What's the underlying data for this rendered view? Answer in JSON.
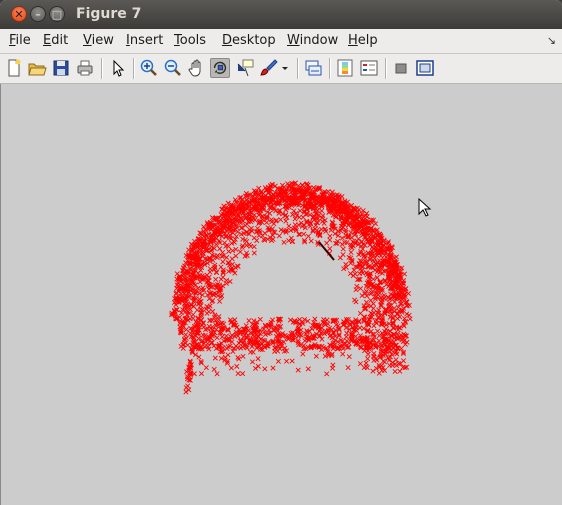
{
  "window": {
    "title": "Figure 7"
  },
  "titlebar_buttons": [
    {
      "name": "close-button",
      "glyph": "✕"
    },
    {
      "name": "minimize-button",
      "glyph": "–"
    },
    {
      "name": "maximize-button",
      "glyph": "□"
    }
  ],
  "menu": {
    "items": [
      {
        "label": "File",
        "mnemonic": "F",
        "rest": "ile"
      },
      {
        "label": "Edit",
        "mnemonic": "E",
        "rest": "dit"
      },
      {
        "label": "View",
        "mnemonic": "V",
        "rest": "iew"
      },
      {
        "label": "Insert",
        "mnemonic": "I",
        "rest": "nsert"
      },
      {
        "label": "Tools",
        "mnemonic": "T",
        "rest": "ools"
      },
      {
        "label": "Desktop",
        "mnemonic": "D",
        "rest": "esktop"
      },
      {
        "label": "Window",
        "mnemonic": "W",
        "rest": "indow"
      },
      {
        "label": "Help",
        "mnemonic": "H",
        "rest": "elp"
      }
    ],
    "dock_arrow": "↘"
  },
  "toolbar": {
    "buttons": [
      "new-figure-icon",
      "open-file-icon",
      "save-icon",
      "print-icon",
      "edit-plot-pointer-icon",
      "zoom-in-icon",
      "zoom-out-icon",
      "pan-hand-icon",
      "rotate-3d-icon",
      "data-cursor-icon",
      "brush-icon",
      "brush-dropdown-icon",
      "link-plot-icon",
      "insert-colorbar-icon",
      "insert-legend-icon",
      "hide-plot-tools-icon",
      "show-plot-tools-icon"
    ],
    "pressed": "rotate-3d-icon"
  },
  "plot": {
    "marker": "x",
    "marker_color": "#ff0000",
    "background": "#cccccc",
    "view": "3-D rotate",
    "description_free": true
  }
}
